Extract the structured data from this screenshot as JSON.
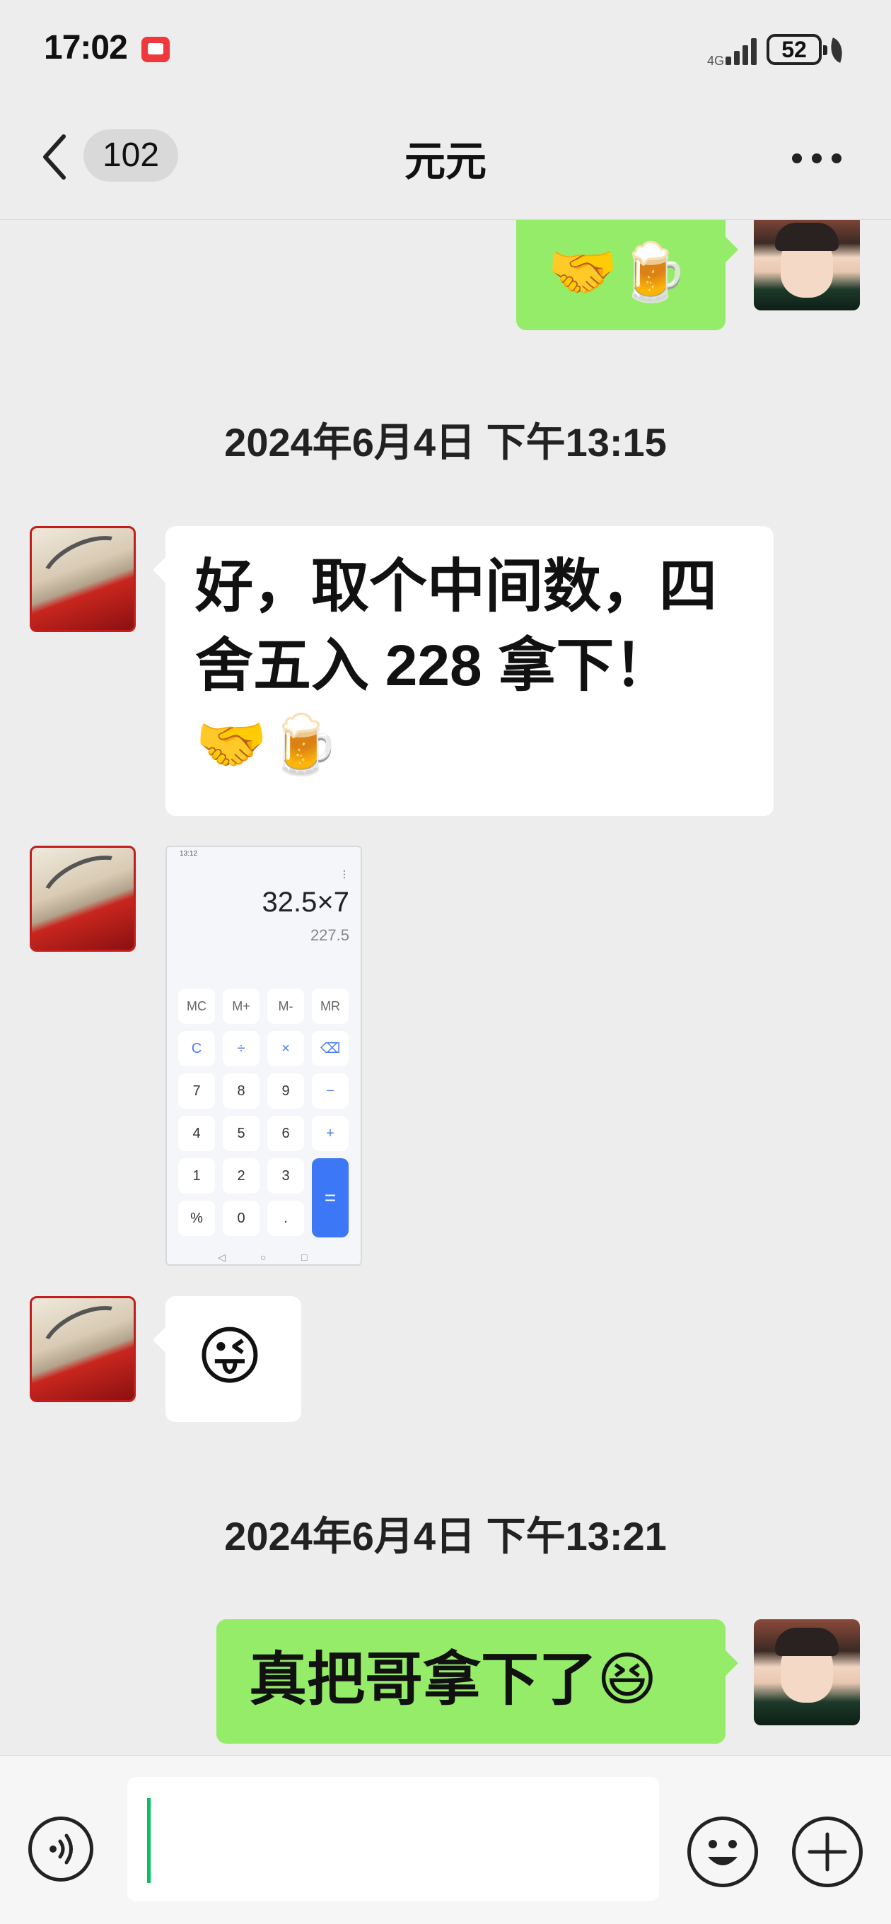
{
  "status_bar": {
    "time": "17:02",
    "network_label": "4G",
    "battery": "52"
  },
  "header": {
    "unread_count": "102",
    "title": "元元"
  },
  "messages": [
    {
      "side": "right",
      "text": "🤝🍺"
    },
    {
      "type": "timestamp",
      "text": "2024年6月4日 下午13:15"
    },
    {
      "side": "left",
      "text": "好，取个中间数，四舍五入 228 拿下！🤝🍺"
    },
    {
      "side": "left",
      "type": "image",
      "calc_expression": "32.5×7",
      "calc_result": "227.5"
    },
    {
      "side": "left",
      "text": "😜"
    },
    {
      "type": "timestamp",
      "text": "2024年6月4日 下午13:21"
    },
    {
      "side": "right",
      "text": "真把哥拿下了😆"
    }
  ],
  "calc_screenshot": {
    "status_time": "13:12",
    "expression": "32.5×7",
    "result": "227.5",
    "keys": [
      [
        "MC",
        "M+",
        "M-",
        "MR"
      ],
      [
        "C",
        "÷",
        "×",
        "⌫"
      ],
      [
        "7",
        "8",
        "9",
        "−"
      ],
      [
        "4",
        "5",
        "6",
        "+"
      ],
      [
        "1",
        "2",
        "3",
        "="
      ],
      [
        "%",
        "0",
        "."
      ]
    ]
  },
  "input_bar": {
    "draft_text": ""
  },
  "icons": {
    "back": "chevron-left-icon",
    "more": "more-dots-icon",
    "voice": "voice-icon",
    "emoji": "emoji-icon",
    "plus": "plus-icon"
  }
}
